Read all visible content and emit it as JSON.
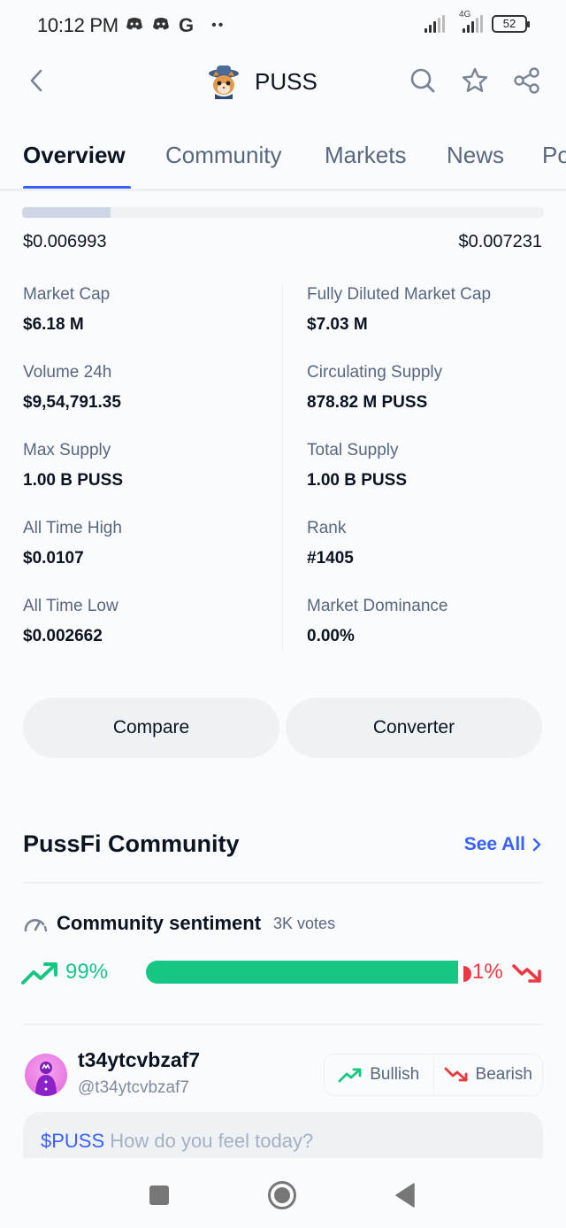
{
  "status_bar": {
    "time": "10:12 PM",
    "notification_icons": [
      "discord-icon",
      "discord-icon",
      "google-icon"
    ],
    "more_dots": "••",
    "network": "4G",
    "battery": "52"
  },
  "header": {
    "coin_symbol": "PUSS",
    "icons": [
      "back-icon",
      "search-icon",
      "star-icon",
      "share-icon"
    ]
  },
  "tabs": [
    {
      "label": "Overview",
      "active": true
    },
    {
      "label": "Community",
      "active": false
    },
    {
      "label": "Markets",
      "active": false
    },
    {
      "label": "News",
      "active": false
    },
    {
      "label": "Portfolio",
      "active": false
    }
  ],
  "price_range": {
    "low": "$0.006993",
    "high": "$0.007231",
    "fill_fraction": 0.17
  },
  "stats": {
    "left": [
      {
        "label": "Market Cap",
        "value": "$6.18 M"
      },
      {
        "label": "Volume 24h",
        "value": "$9,54,791.35"
      },
      {
        "label": "Max Supply",
        "value": "1.00 B PUSS"
      },
      {
        "label": "All Time High",
        "value": "$0.0107"
      },
      {
        "label": "All Time Low",
        "value": "$0.002662"
      }
    ],
    "right": [
      {
        "label": "Fully Diluted Market Cap",
        "value": "$7.03 M"
      },
      {
        "label": "Circulating Supply",
        "value": "878.82 M PUSS"
      },
      {
        "label": "Total Supply",
        "value": "1.00 B PUSS"
      },
      {
        "label": "Rank",
        "value": "#1405"
      },
      {
        "label": "Market Dominance",
        "value": "0.00%"
      }
    ]
  },
  "actions": {
    "compare": "Compare",
    "converter": "Converter"
  },
  "community": {
    "title": "PussFi Community",
    "see_all": "See All",
    "sentiment_title": "Community sentiment",
    "votes": "3K votes",
    "bullish_pct": "99%",
    "bearish_pct": "1%",
    "bullish_fraction": 0.99,
    "colors": {
      "bullish": "#16c784",
      "bearish": "#ea3943",
      "accent": "#3861fb"
    }
  },
  "composer": {
    "username": "t34ytcvbzaf7",
    "handle": "@t34ytcvbzaf7",
    "bullish_label": "Bullish",
    "bearish_label": "Bearish",
    "ticker": "$PUSS",
    "placeholder": "How do you feel today?"
  },
  "navbar": {
    "buttons": [
      "recents-icon",
      "home-icon",
      "back-icon"
    ]
  }
}
